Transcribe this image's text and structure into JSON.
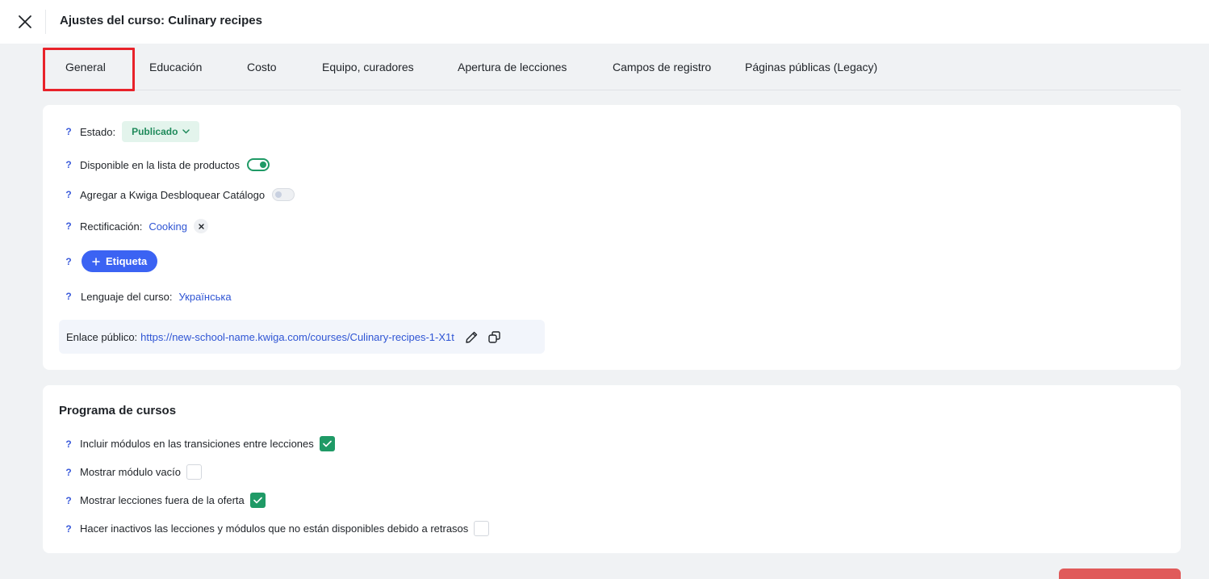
{
  "header": {
    "title": "Ajustes del curso: Culinary recipes",
    "close_icon": "close-icon"
  },
  "tabs": [
    {
      "label": "General",
      "active": true
    },
    {
      "label": "Educación"
    },
    {
      "label": "Costo"
    },
    {
      "label": "Equipo, curadores"
    },
    {
      "label": "Apertura de lecciones"
    },
    {
      "label": "Campos de registro"
    },
    {
      "label": "Páginas públicas (Legacy)"
    }
  ],
  "general": {
    "help_glyph": "?",
    "status_label": "Estado:",
    "status_value": "Publicado",
    "available_label": "Disponible en la lista de productos",
    "available_on": true,
    "catalog_label": "Agregar a Kwiga Desbloquear Catálogo",
    "catalog_on": false,
    "category_label": "Rectificación:",
    "category_value": "Cooking",
    "tag_button": "Etiqueta",
    "language_label": "Lenguaje del curso:",
    "language_value": "Українська",
    "public_link_label": "Enlace público:",
    "public_link_url": "https://new-school-name.kwiga.com/courses/Culinary-recipes-1-X1t"
  },
  "program": {
    "title": "Programa de cursos",
    "items": [
      {
        "label": "Incluir módulos en las transiciones entre lecciones",
        "checked": true
      },
      {
        "label": "Mostrar módulo vacío",
        "checked": false
      },
      {
        "label": "Mostrar lecciones fuera de la oferta",
        "checked": true
      },
      {
        "label": "Hacer inactivos las lecciones y módulos que no están disponibles debido a retrasos",
        "checked": false
      }
    ]
  },
  "colors": {
    "accent_blue": "#3b63f3",
    "success_green": "#1f9a66",
    "highlight_red": "#e8222a",
    "danger": "#e05a5a"
  }
}
